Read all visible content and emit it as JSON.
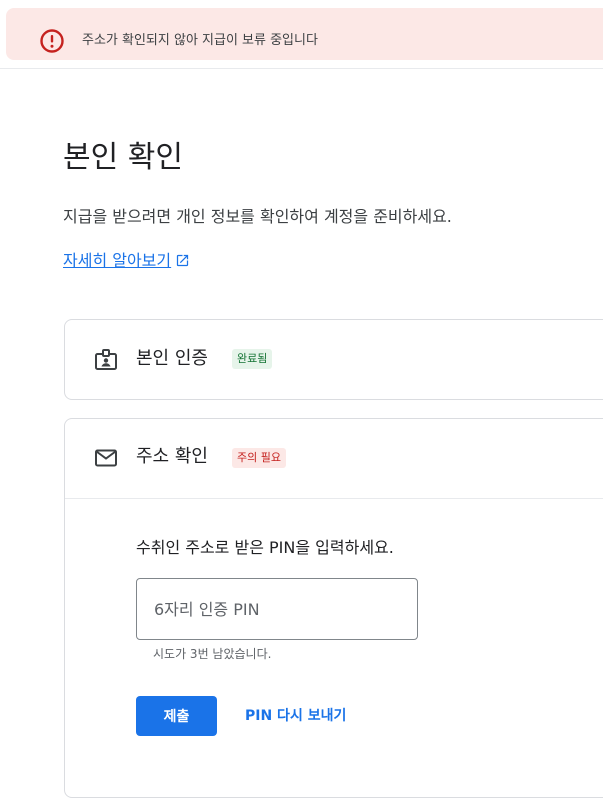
{
  "alert": {
    "icon": "error-circle-icon",
    "color": "#c5221f",
    "message": "주소가 확인되지 않아 지급이 보류 중입니다"
  },
  "page": {
    "title": "본인 확인",
    "subtitle": "지급을 받으려면 개인 정보를 확인하여 계정을 준비하세요.",
    "learn_more": "자세히 알아보기",
    "learn_more_icon": "open-in-new-icon"
  },
  "identity_card": {
    "icon": "id-badge-icon",
    "title": "본인 인증",
    "status": "완료됨",
    "status_color": "#137333"
  },
  "address_card": {
    "icon": "mail-icon",
    "title": "주소 확인",
    "status": "주의 필요",
    "status_color": "#c5221f",
    "instruction": "수취인 주소로 받은 PIN을 입력하세요.",
    "pin_placeholder": "6자리 인증 PIN",
    "pin_value": "",
    "helper": "시도가 3번 남았습니다.",
    "submit_label": "제출",
    "resend_label": "PIN 다시 보내기"
  },
  "colors": {
    "accent": "#1a73e8",
    "alert_bg": "#fce8e6"
  }
}
